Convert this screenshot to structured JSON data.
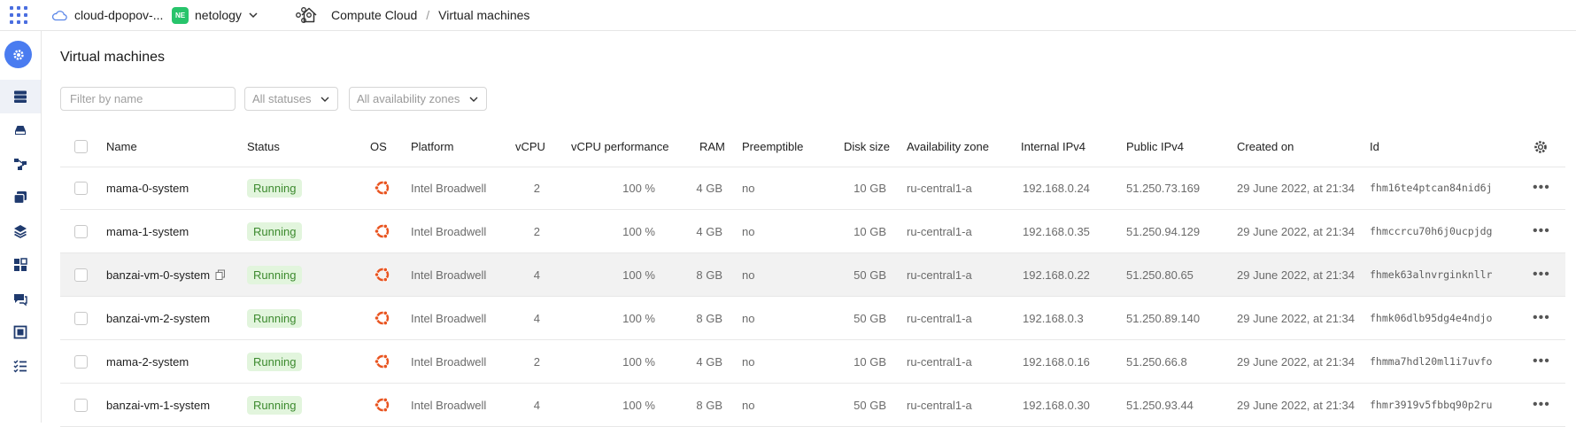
{
  "topbar": {
    "cloud_name": "cloud-dpopov-...",
    "org_badge": "NE",
    "org_name": "netology",
    "service": "Compute Cloud",
    "separator": "/",
    "current_page": "Virtual machines"
  },
  "rail": {
    "logo_icon": "gear-icon",
    "items": [
      "servers-icon",
      "disk-icon",
      "network-icon",
      "images-icon",
      "layers-icon",
      "groups-icon",
      "snapshots-icon",
      "frame-icon",
      "checklist-icon"
    ]
  },
  "page": {
    "title": "Virtual machines",
    "filter_placeholder": "Filter by name",
    "status_filter": "All statuses",
    "zone_filter": "All availability zones"
  },
  "table": {
    "columns": [
      "Name",
      "Status",
      "OS",
      "Platform",
      "vCPU",
      "vCPU performance",
      "RAM",
      "Preemptible",
      "Disk size",
      "Availability zone",
      "Internal IPv4",
      "Public IPv4",
      "Created on",
      "Id"
    ],
    "rows": [
      {
        "name": "mama-0-system",
        "status": "Running",
        "os": "ubuntu-icon",
        "platform": "Intel Broadwell",
        "vcpu": "2",
        "perf": "100 %",
        "ram": "4 GB",
        "preemptible": "no",
        "disk": "10 GB",
        "zone": "ru-central1-a",
        "internal_ip": "192.168.0.24",
        "public_ip": "51.250.73.169",
        "created": "29 June 2022, at 21:34",
        "id": "fhm16te4ptcan84nid6j"
      },
      {
        "name": "mama-1-system",
        "status": "Running",
        "os": "ubuntu-icon",
        "platform": "Intel Broadwell",
        "vcpu": "2",
        "perf": "100 %",
        "ram": "4 GB",
        "preemptible": "no",
        "disk": "10 GB",
        "zone": "ru-central1-a",
        "internal_ip": "192.168.0.35",
        "public_ip": "51.250.94.129",
        "created": "29 June 2022, at 21:34",
        "id": "fhmccrcu70h6j0ucpjdg"
      },
      {
        "name": "banzai-vm-0-system",
        "status": "Running",
        "os": "ubuntu-icon",
        "platform": "Intel Broadwell",
        "vcpu": "4",
        "perf": "100 %",
        "ram": "8 GB",
        "preemptible": "no",
        "disk": "50 GB",
        "zone": "ru-central1-a",
        "internal_ip": "192.168.0.22",
        "public_ip": "51.250.80.65",
        "created": "29 June 2022, at 21:34",
        "id": "fhmek63alnvrginknllr"
      },
      {
        "name": "banzai-vm-2-system",
        "status": "Running",
        "os": "ubuntu-icon",
        "platform": "Intel Broadwell",
        "vcpu": "4",
        "perf": "100 %",
        "ram": "8 GB",
        "preemptible": "no",
        "disk": "50 GB",
        "zone": "ru-central1-a",
        "internal_ip": "192.168.0.3",
        "public_ip": "51.250.89.140",
        "created": "29 June 2022, at 21:34",
        "id": "fhmk06dlb95dg4e4ndjo"
      },
      {
        "name": "mama-2-system",
        "status": "Running",
        "os": "ubuntu-icon",
        "platform": "Intel Broadwell",
        "vcpu": "2",
        "perf": "100 %",
        "ram": "4 GB",
        "preemptible": "no",
        "disk": "10 GB",
        "zone": "ru-central1-a",
        "internal_ip": "192.168.0.16",
        "public_ip": "51.250.66.8",
        "created": "29 June 2022, at 21:34",
        "id": "fhmma7hdl20ml1i7uvfo"
      },
      {
        "name": "banzai-vm-1-system",
        "status": "Running",
        "os": "ubuntu-icon",
        "platform": "Intel Broadwell",
        "vcpu": "4",
        "perf": "100 %",
        "ram": "8 GB",
        "preemptible": "no",
        "disk": "50 GB",
        "zone": "ru-central1-a",
        "internal_ip": "192.168.0.30",
        "public_ip": "51.250.93.44",
        "created": "29 June 2022, at 21:34",
        "id": "fhmr3919v5fbbq90p2ru"
      }
    ],
    "hovered_row_index": 2,
    "row_actions_label": "•••"
  },
  "colors": {
    "accent": "#4a7cf0",
    "running_bg": "#e2f5dd",
    "running_text": "#3c8a2e",
    "ubuntu": "#e95420",
    "org_badge": "#27c46b"
  }
}
